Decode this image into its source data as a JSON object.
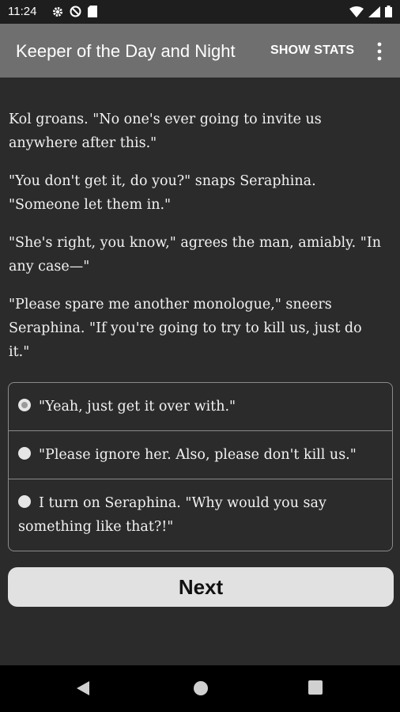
{
  "status_bar": {
    "time": "11:24"
  },
  "app_bar": {
    "title": "Keeper of the Day and Night",
    "show_stats_label": "SHOW STATS"
  },
  "story": {
    "paragraphs": [
      "Kol groans. \"No one's ever going to invite us anywhere after this.\"",
      "\"You don't get it, do you?\" snaps Seraphina. \"Someone let them in.\"",
      "\"She's right, you know,\" agrees the man, amiably. \"In any case—\"",
      "\"Please spare me another monologue,\" sneers Seraphina. \"If you're going to try to kill us, just do it.\""
    ]
  },
  "choices": [
    {
      "label": "\"Yeah, just get it over with.\"",
      "selected": true
    },
    {
      "label": "\"Please ignore her. Also, please don't kill us.\"",
      "selected": false
    },
    {
      "label": "I turn on Seraphina. \"Why would you say something like that?!\"",
      "selected": false
    }
  ],
  "next_button": {
    "label": "Next"
  },
  "icons": {
    "status_left": [
      "settings-icon",
      "dnd-icon",
      "sd-card-icon"
    ],
    "status_right": [
      "wifi-icon",
      "signal-icon",
      "battery-icon"
    ],
    "app_bar": [
      "more-vert-icon"
    ],
    "nav": [
      "back-icon",
      "home-icon",
      "recents-icon"
    ]
  },
  "colors": {
    "background": "#2b2b2b",
    "app_bar": "#6f6f6f",
    "status_bar": "#1e1e1e",
    "button": "#e1e1e1"
  }
}
